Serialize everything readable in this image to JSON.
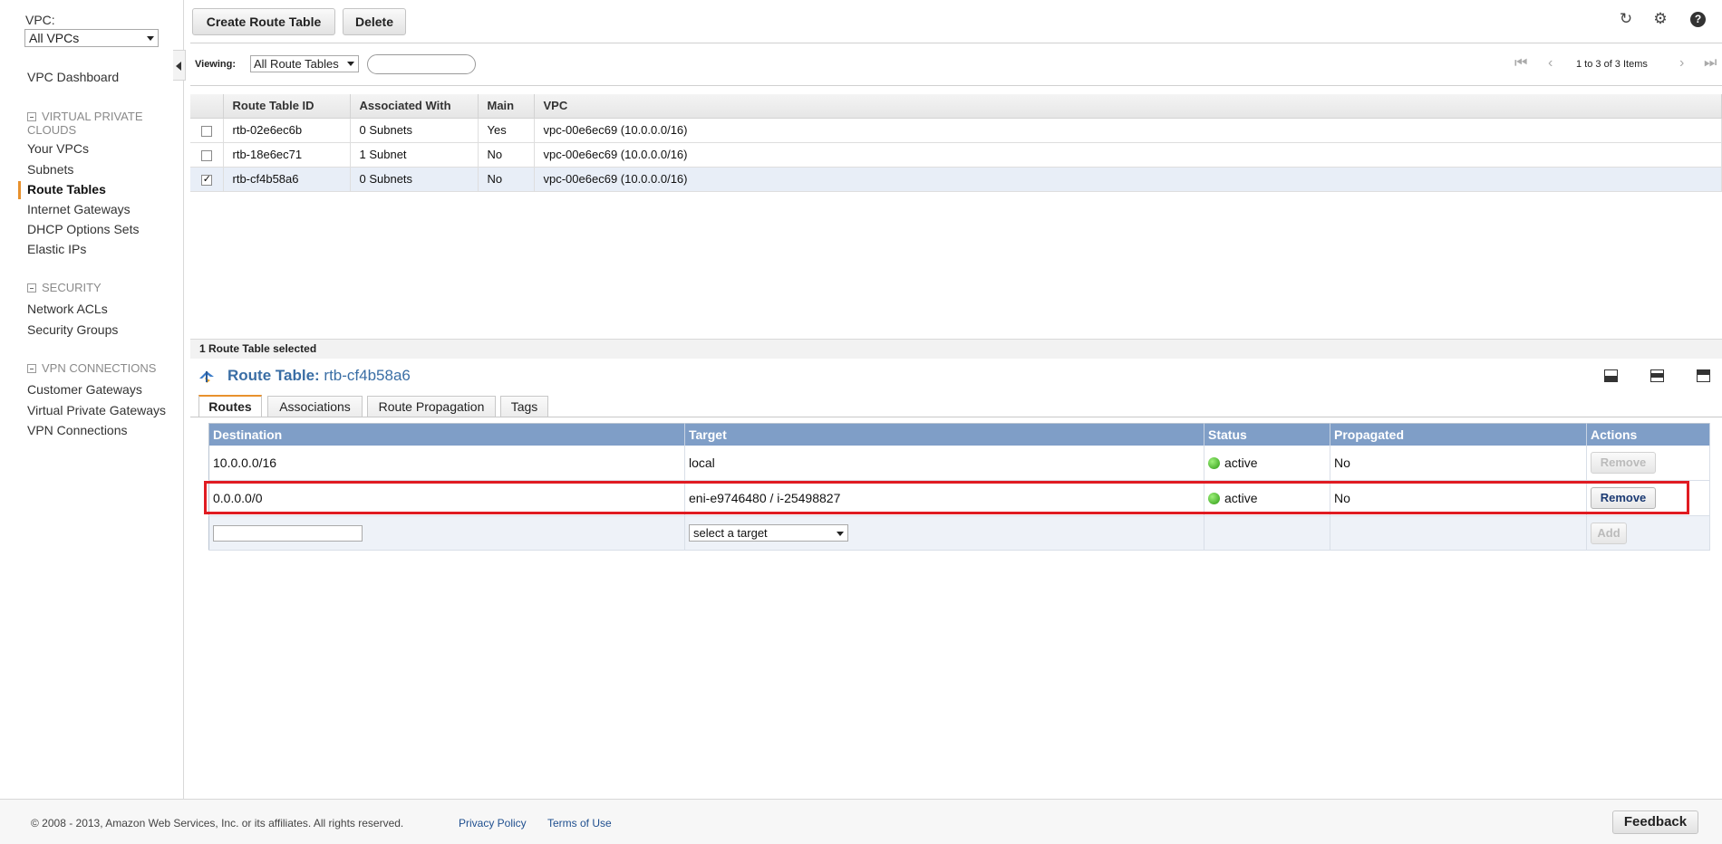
{
  "sidebar": {
    "vpc_label": "VPC:",
    "vpc_selected": "All VPCs",
    "dashboard": "VPC Dashboard",
    "sections": [
      {
        "title": "VIRTUAL PRIVATE CLOUDS",
        "items": [
          "Your VPCs",
          "Subnets",
          "Route Tables",
          "Internet Gateways",
          "DHCP Options Sets",
          "Elastic IPs"
        ]
      },
      {
        "title": "SECURITY",
        "items": [
          "Network ACLs",
          "Security Groups"
        ]
      },
      {
        "title": "VPN CONNECTIONS",
        "items": [
          "Customer Gateways",
          "Virtual Private Gateways",
          "VPN Connections"
        ]
      }
    ],
    "active_item": "Route Tables"
  },
  "toolbar": {
    "create_label": "Create Route Table",
    "delete_label": "Delete",
    "icons": [
      "refresh-icon",
      "gear-icon",
      "help-icon"
    ]
  },
  "viewing": {
    "label": "Viewing:",
    "selected": "All Route Tables",
    "search_value": "",
    "pager_text": "1 to 3 of 3 Items"
  },
  "route_tables": {
    "columns": [
      "Route Table ID",
      "Associated With",
      "Main",
      "VPC"
    ],
    "rows": [
      {
        "id": "rtb-02e6ec6b",
        "associated": "0 Subnets",
        "main": "Yes",
        "vpc": "vpc-00e6ec69 (10.0.0.0/16)",
        "checked": false
      },
      {
        "id": "rtb-18e6ec71",
        "associated": "1 Subnet",
        "main": "No",
        "vpc": "vpc-00e6ec69 (10.0.0.0/16)",
        "checked": false
      },
      {
        "id": "rtb-cf4b58a6",
        "associated": "0 Subnets",
        "main": "No",
        "vpc": "vpc-00e6ec69 (10.0.0.0/16)",
        "checked": true
      }
    ]
  },
  "detail": {
    "selected_text": "1 Route Table selected",
    "title_prefix": "Route Table:",
    "title_id": "rtb-cf4b58a6",
    "tabs": [
      "Routes",
      "Associations",
      "Route Propagation",
      "Tags"
    ],
    "active_tab": "Routes"
  },
  "routes": {
    "columns": [
      "Destination",
      "Target",
      "Status",
      "Propagated",
      "Actions"
    ],
    "rows": [
      {
        "destination": "10.0.0.0/16",
        "target": "local",
        "status": "active",
        "propagated": "No",
        "action": "Remove",
        "action_enabled": false
      },
      {
        "destination": "0.0.0.0/0",
        "target": "eni-e9746480 / i-25498827",
        "status": "active",
        "propagated": "No",
        "action": "Remove",
        "action_enabled": true
      }
    ],
    "new_row": {
      "destination_value": "",
      "target_selected": "select a target",
      "add_label": "Add"
    }
  },
  "footer": {
    "copyright": "© 2008 - 2013, Amazon Web Services, Inc. or its affiliates. All rights reserved.",
    "privacy": "Privacy Policy",
    "terms": "Terms of Use",
    "feedback": "Feedback"
  },
  "colors": {
    "accent": "#e8912d",
    "header_blue": "#7f9ec7",
    "title_blue": "#3a6ea5",
    "highlight": "#e01b22",
    "status_green": "#2d9a13"
  }
}
